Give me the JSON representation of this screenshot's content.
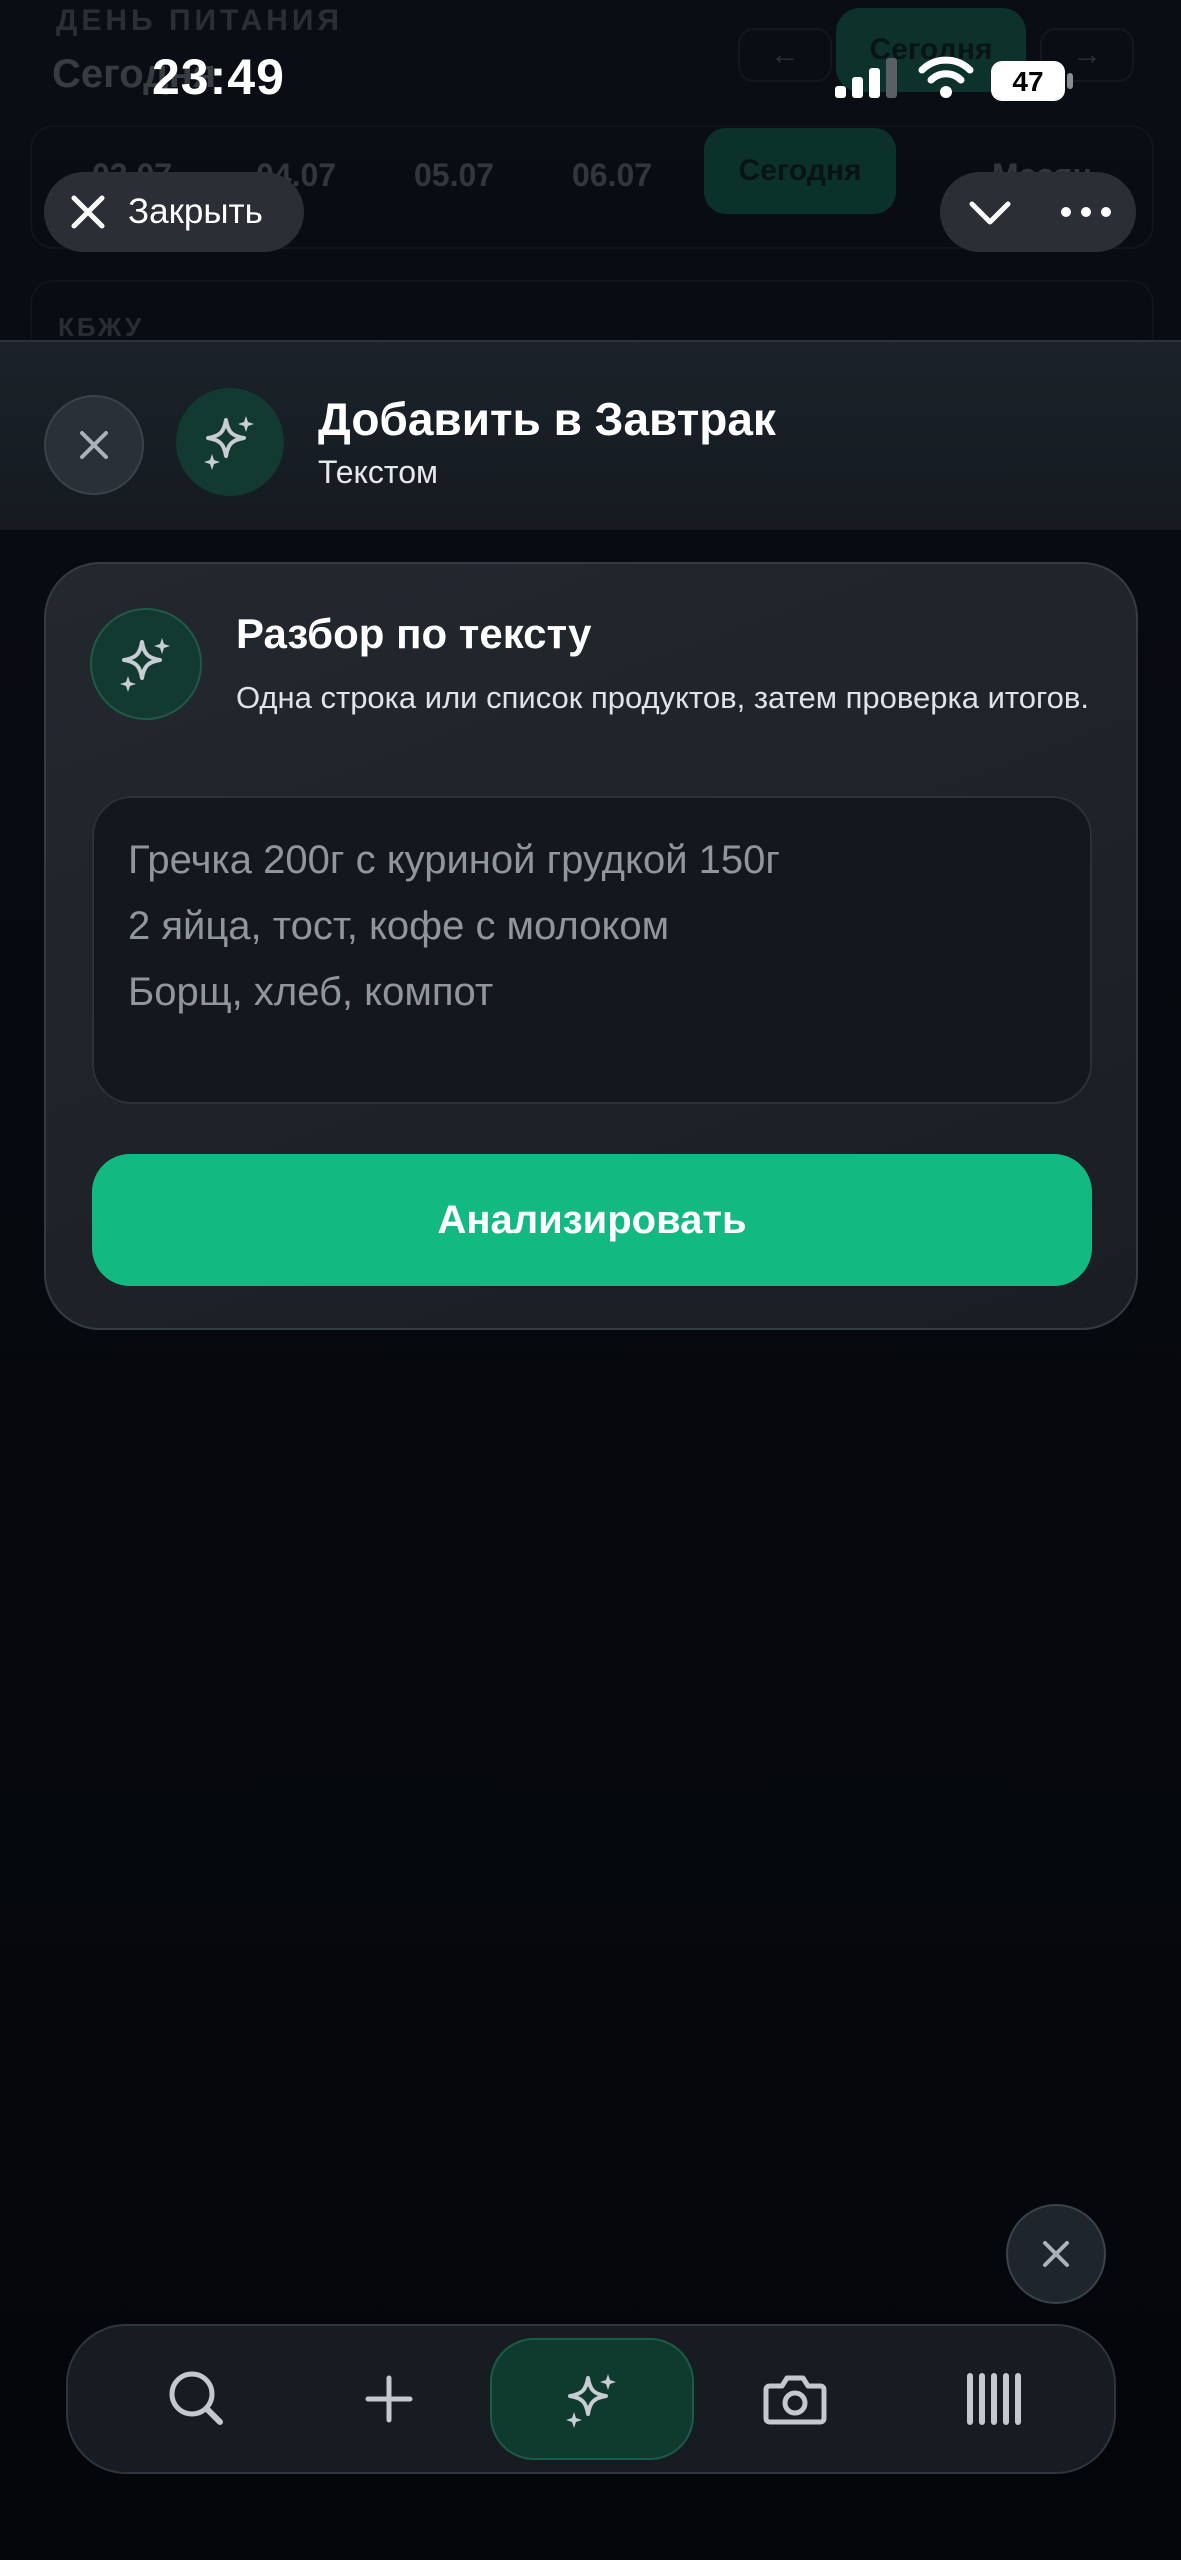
{
  "status_bar": {
    "time": "23:49",
    "battery": "47"
  },
  "background": {
    "section_label": "ДЕНЬ ПИТАНИЯ",
    "title": "Сегодня",
    "today_button": "Сегодня",
    "dates": [
      "03.07",
      "04.07",
      "05.07",
      "06.07"
    ],
    "active_date": "Сегодня",
    "month_label": "Месяц",
    "kbju_label": "КБЖУ"
  },
  "top_bar": {
    "close_label": "Закрыть"
  },
  "header": {
    "title": "Добавить в Завтрак",
    "subtitle": "Текстом"
  },
  "card": {
    "title": "Разбор по тексту",
    "description": "Одна строка или список продуктов, затем проверка итогов.",
    "placeholder_lines": [
      "Гречка 200г с куриной грудкой 150г",
      "2 яйца, тост, кофе с молоком",
      "Борщ, хлеб, компот"
    ],
    "analyze_label": "Анализировать"
  },
  "bottom_bar": {
    "items": [
      "search-icon",
      "plus-icon",
      "sparkles-icon",
      "camera-icon",
      "barcode-icon"
    ],
    "active": "sparkles-icon"
  },
  "colors": {
    "accent": "#12b981",
    "accent_dark": "#0f3a2e",
    "background": "#05070c"
  }
}
